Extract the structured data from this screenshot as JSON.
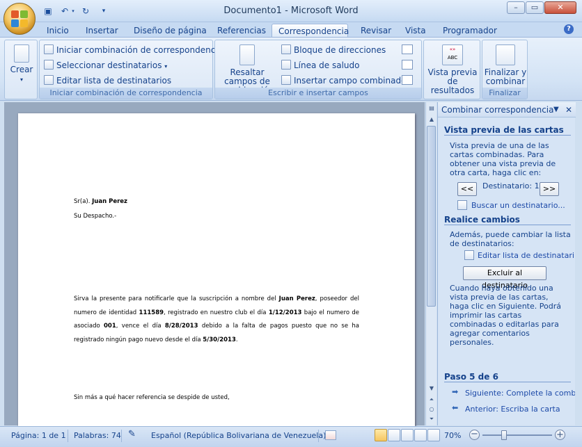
{
  "window": {
    "title": "Documento1 - Microsoft Word"
  },
  "quick_access": [
    {
      "icon": "save-icon"
    },
    {
      "icon": "undo-icon"
    },
    {
      "icon": "redo-icon"
    },
    {
      "icon": "customize-icon"
    }
  ],
  "tabs": [
    {
      "label": "Inicio"
    },
    {
      "label": "Insertar"
    },
    {
      "label": "Diseño de página"
    },
    {
      "label": "Referencias"
    },
    {
      "label": "Correspondencia",
      "active": true
    },
    {
      "label": "Revisar"
    },
    {
      "label": "Vista"
    },
    {
      "label": "Programador"
    }
  ],
  "ribbon": {
    "crear": {
      "label": "Crear"
    },
    "iniciar_group": {
      "label": "Iniciar combinación de correspondencia",
      "items": [
        "Iniciar combinación de correspondencia",
        "Seleccionar destinatarios",
        "Editar lista de destinatarios"
      ]
    },
    "escribir_group": {
      "label": "Escribir e insertar campos",
      "resaltar": "Resaltar campos de combinación",
      "items": [
        "Bloque de direcciones",
        "Línea de saludo",
        "Insertar campo combinado"
      ]
    },
    "vista_previa": {
      "label": "Vista previa de resultados"
    },
    "finalizar_group": {
      "label": "Finalizar",
      "button": "Finalizar y combinar"
    }
  },
  "document": {
    "salutation_prefix": "Sr(a). ",
    "name": "Juan Perez",
    "despacho": "Su Despacho.-",
    "p1": "Sirva la presente para notificarle que la suscripción a nombre del",
    "p1b": ", poseedor del numero de identidad",
    "id_number": "111589",
    "p1c": ", registrado en nuestro club el día",
    "reg_date": "1/12/2013",
    "p1d": "bajo el numero de asociado",
    "member_no": "001",
    "p1e": ", vence el día",
    "due_date": "8/28/2013",
    "p1f": "debido a la falta de pagos puesto que no se ha registrado ningún pago nuevo desde el día",
    "last_date": "5/30/2013",
    "closing": "Sin más a qué hacer referencia se despide de usted,"
  },
  "task_pane": {
    "title": "Combinar correspondencia",
    "preview_title": "Vista previa de las cartas",
    "preview_text": "Vista previa de una de las cartas combinadas. Para obtener una vista previa de otra carta, haga clic en:",
    "prev_label": "<<",
    "next_label": ">>",
    "recipient_label": "Destinatario: 1",
    "find_link": "Buscar un destinatario...",
    "changes_title": "Realice cambios",
    "changes_text": "Además, puede cambiar la lista de destinatarios:",
    "edit_link": "Editar lista de destinatarios...",
    "exclude_button": "Excluir al destinatario",
    "final_text": "Cuando haya obtenido una vista previa de las cartas, haga clic en Siguiente. Podrá imprimir las cartas combinadas o editarlas para agregar comentarios personales.",
    "step": "Paso 5 de 6",
    "next_step": "Siguiente: Complete la combinación",
    "prev_step": "Anterior: Escriba la carta"
  },
  "status_bar": {
    "page": "Página: 1 de 1",
    "words": "Palabras: 74",
    "language": "Español (República Bolivariana de Venezuela)",
    "zoom": "70%"
  }
}
